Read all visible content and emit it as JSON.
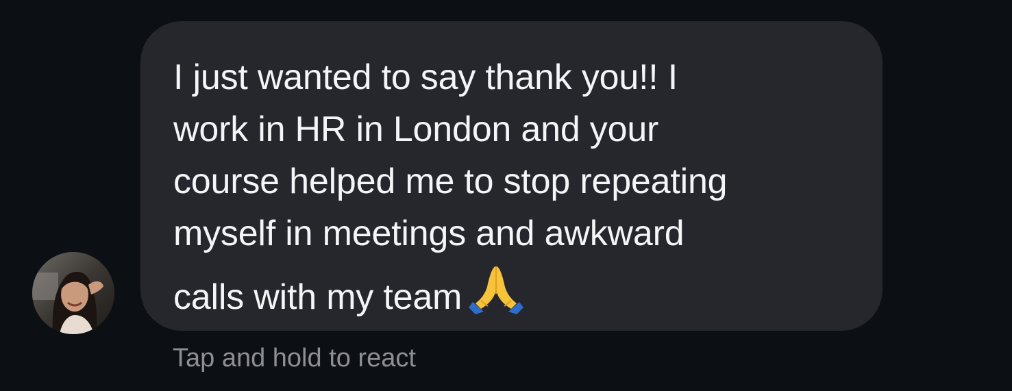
{
  "message": {
    "lines": [
      "I just wanted to say thank you!! I",
      "work in HR in London and your",
      "course helped me to stop repeating",
      "myself in meetings and awkward",
      "calls with my team"
    ],
    "emoji": "folded-hands-emoji"
  },
  "hint": {
    "label": "Tap and hold to react"
  },
  "colors": {
    "background": "#0c1014",
    "bubble": "#26272c",
    "text": "#f5f5f7",
    "hint": "#8e8e93"
  }
}
